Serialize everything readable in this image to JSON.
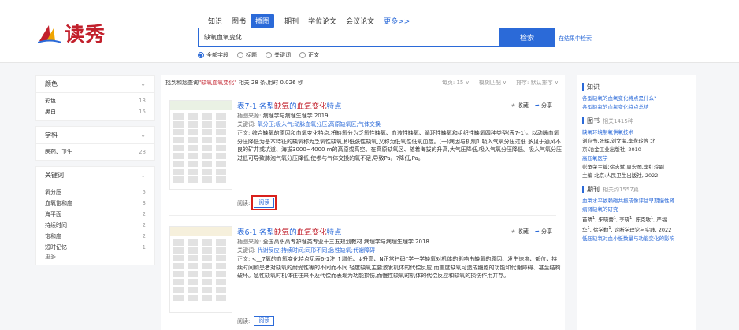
{
  "logo": {
    "text": "读秀"
  },
  "nav": {
    "tabs": [
      "知识",
      "图书",
      "插图",
      "期刊",
      "学位论文",
      "会议论文"
    ],
    "active_index": 2,
    "more": "更多>>"
  },
  "search": {
    "value": "缺氧血氧变化",
    "button": "检索",
    "within": "在结果中检索"
  },
  "scope_options": [
    {
      "label": "全部字段",
      "checked": true
    },
    {
      "label": "标题",
      "checked": false
    },
    {
      "label": "关键词",
      "checked": false
    },
    {
      "label": "正文",
      "checked": false
    }
  ],
  "facets": [
    {
      "title": "颜色",
      "items": [
        {
          "label": "彩色",
          "count": "13"
        },
        {
          "label": "黑白",
          "count": "15"
        }
      ]
    },
    {
      "title": "学科",
      "items": [
        {
          "label": "医药、卫生",
          "count": "28"
        }
      ]
    },
    {
      "title": "关键词",
      "items": [
        {
          "label": "氧分压",
          "count": "5"
        },
        {
          "label": "血氧饱和度",
          "count": "3"
        },
        {
          "label": "海平面",
          "count": "2"
        },
        {
          "label": "持续时间",
          "count": "2"
        },
        {
          "label": "饱和度",
          "count": "2"
        },
        {
          "label": "短时记忆",
          "count": "1"
        }
      ],
      "more": "更多..."
    }
  ],
  "result_bar": {
    "prefix": "找到和您查询",
    "keyword": "\"缺氧血氧变化\"",
    "suffix": "相关 28 条,用时 0.026 秒",
    "per_page": "每页: 15 ∨",
    "match": "模糊匹配 ∨",
    "sort": "排序: 默认排序 ∨"
  },
  "results": [
    {
      "title_pre": "表7-1 各型",
      "title_hl": "缺氧",
      "title_mid": "的",
      "title_hl2": "血氧变化",
      "title_post": "特点",
      "source_label": "插图来源:",
      "source": "病理学与病理生理学 2019",
      "keywords_label": "关键词:",
      "keywords": "氧分压;吸入气;动脉血氧分压;高原缺氧区;气体交换",
      "body_label": "正文:",
      "body": "综合缺氧的原因和血氧变化特点,将缺氧分为乏氧性缺氧、血液性缺氧、循环性缺氧和组织性缺氧四种类型(表7-1)。以动脉血氧分压降低为基本特征的缺氧称为乏氧性缺氧,即低张性缺氧,又称为低氧性低氧血症。(一)病因与机制1.吸入气氧分压过低 多见于通风不良的矿井或坑道、海拔3000~4000 m的高原或高空。在高原缺氧区、随着海拔的升高,大气压降低,吸入气氧分压降低。吸入气氧分压过低可导致肺泡气氧分压降低,使参与气体交换的氧不足,导致Pa。?降低,Pa。",
      "read_label": "阅读:",
      "read_button": "阅读",
      "collect": "收藏",
      "share": "分享"
    },
    {
      "title_pre": "表6-1 各型",
      "title_hl": "缺氧",
      "title_mid": "的",
      "title_hl2": "血氧变化",
      "title_post": "特点",
      "source_label": "插图来源:",
      "source": "全国高职高专护理类专业十三五规划教材 病理学与病理生理学 2018",
      "keywords_label": "关键词:",
      "keywords": "代谢反应;持续时间;同形不同;急性缺氧;代谢障碍",
      "body_label": "正文:",
      "body": "<__7氧的血氧变化特点见表6-1注:↑增低、↓升高、N正常扫码“学一学缺氧对机体的影响由缺氧的原因、发生速度、部位、持续时间和患者对缺氧的耐受性等的不同而不同 轻度缺氧主要激发机体的代偿反应,而重度缺氧可造成细胞的功能和代谢障碍、甚至结构破坏。急性缺氧时机体往往来不及代偿而表现为功能损伤,而慢性缺氧时机体的代偿反应和缺氧的损伤作用并存。",
      "read_label": "阅读:",
      "read_button": "阅读",
      "collect": "收藏",
      "share": "分享"
    }
  ],
  "side": {
    "zhishi": {
      "title": "知识",
      "lines": [
        "各型缺氧的血氧变化特点是什么?",
        "各型缺氧的血氧变化特点总结"
      ]
    },
    "books": {
      "title": "图书",
      "count": "相关1415种",
      "b1_title": "缺氧环境制氧供氧技术",
      "b1_line1": "刘应书,张辉,刘文海,李永玲等 北",
      "b1_line2": "京:冶金工业出版社, 2010",
      "b2_title": "高压氧医学",
      "b2_line1": "彭争荣主编;徐志斌,周宏图,李红玲副",
      "b2_line2": "主编 北京:人民卫生出版社, 2022"
    },
    "journals": {
      "title": "期刊",
      "count": "相关约1557篇",
      "j1_line1": "血氧水平依赖磁共振成像评估早期慢性肾",
      "j1_line2": "病肾缺氧的研究",
      "j1_authors": "苗晴",
      "j1_authors2": "朱晓蕾",
      "j1_authors3": "李晓",
      "j1_authors4": "陈克敏",
      "j1_authors5": "严福",
      "j1_line3": "华",
      "j1_line3b": "徐学勤",
      "j1_line3c": "诊断学理论与实践, 2022",
      "j2_line": "低压缺氧对血小板数量与功能变化的影响"
    }
  }
}
